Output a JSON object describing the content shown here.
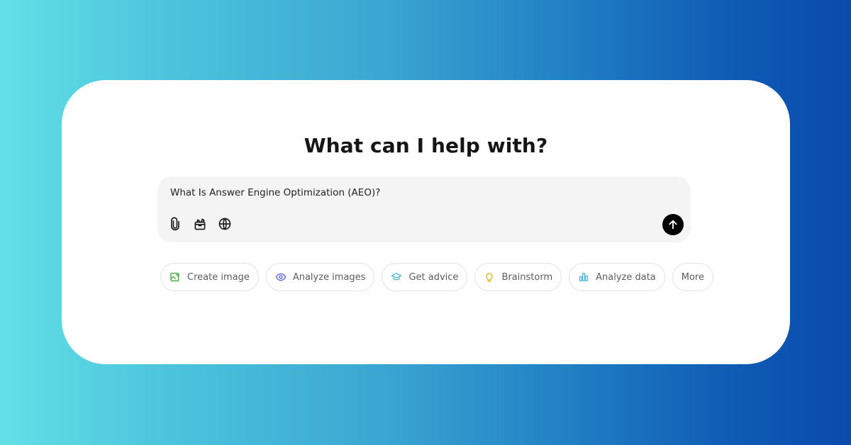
{
  "heading": "What can I help with?",
  "composer": {
    "input_value": "What Is Answer Engine Optimization (AEO)?",
    "tools": [
      {
        "icon": "paperclip-icon",
        "label": "Attach"
      },
      {
        "icon": "toolbox-icon",
        "label": "Tools"
      },
      {
        "icon": "globe-icon",
        "label": "Search"
      }
    ],
    "send_icon": "arrow-up-icon"
  },
  "chips": [
    {
      "label": "Create image",
      "icon": "create-image-icon",
      "color": "#4caf50"
    },
    {
      "label": "Analyze images",
      "icon": "eye-icon",
      "color": "#6b6bdc"
    },
    {
      "label": "Get advice",
      "icon": "graduation-cap-icon",
      "color": "#55b8d8"
    },
    {
      "label": "Brainstorm",
      "icon": "lightbulb-icon",
      "color": "#e6b93a"
    },
    {
      "label": "Analyze data",
      "icon": "bar-chart-icon",
      "color": "#5fb5e0"
    },
    {
      "label": "More",
      "icon": null,
      "color": null
    }
  ],
  "colors": {
    "gradient_start": "#62e0e6",
    "gradient_end": "#0a4aaa",
    "send_button": "#000000"
  }
}
